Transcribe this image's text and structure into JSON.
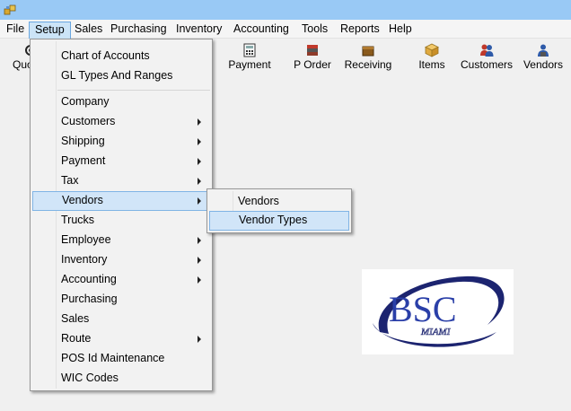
{
  "menubar": {
    "items": [
      {
        "label": "File"
      },
      {
        "label": "Setup"
      },
      {
        "label": "Sales"
      },
      {
        "label": "Purchasing"
      },
      {
        "label": "Inventory"
      },
      {
        "label": "Accounting"
      },
      {
        "label": "Tools"
      },
      {
        "label": "Reports"
      },
      {
        "label": "Help"
      }
    ],
    "active": "Setup"
  },
  "toolbar": {
    "buttons": [
      {
        "label": "Quo",
        "icon": "quote-icon"
      },
      {
        "label": "Payment",
        "icon": "payment-icon"
      },
      {
        "label": "P Order",
        "icon": "purchase-order-icon"
      },
      {
        "label": "Receiving",
        "icon": "receiving-icon"
      },
      {
        "label": "Items",
        "icon": "items-box-icon"
      },
      {
        "label": "Customers",
        "icon": "customers-icon"
      },
      {
        "label": "Vendors",
        "icon": "vendors-icon"
      }
    ]
  },
  "setup_menu": {
    "items": [
      {
        "label": "Chart of Accounts",
        "submenu": false
      },
      {
        "label": "GL Types And Ranges",
        "submenu": false
      },
      {
        "label": "Company",
        "submenu": false
      },
      {
        "label": "Customers",
        "submenu": true
      },
      {
        "label": "Shipping",
        "submenu": true
      },
      {
        "label": "Payment",
        "submenu": true
      },
      {
        "label": "Tax",
        "submenu": true
      },
      {
        "label": "Vendors",
        "submenu": true
      },
      {
        "label": "Trucks",
        "submenu": false
      },
      {
        "label": "Employee",
        "submenu": true
      },
      {
        "label": "Inventory",
        "submenu": true
      },
      {
        "label": "Accounting",
        "submenu": true
      },
      {
        "label": "Purchasing",
        "submenu": false
      },
      {
        "label": "Sales",
        "submenu": false
      },
      {
        "label": "Route",
        "submenu": true
      },
      {
        "label": "POS Id Maintenance",
        "submenu": false
      },
      {
        "label": "WIC Codes",
        "submenu": false
      }
    ],
    "highlighted": "Vendors"
  },
  "vendors_submenu": {
    "items": [
      {
        "label": "Vendors"
      },
      {
        "label": "Vendor Types"
      }
    ],
    "highlighted": "Vendor Types"
  },
  "logo": {
    "text": "BSC",
    "subtext": "MIAMI",
    "colors": {
      "primary": "#2a3fa8",
      "swoosh": "#1c2470"
    }
  },
  "colors": {
    "titlebar": "#99c9f5",
    "highlight": "#d1e5f8",
    "highlight_border": "#80b4e5"
  }
}
